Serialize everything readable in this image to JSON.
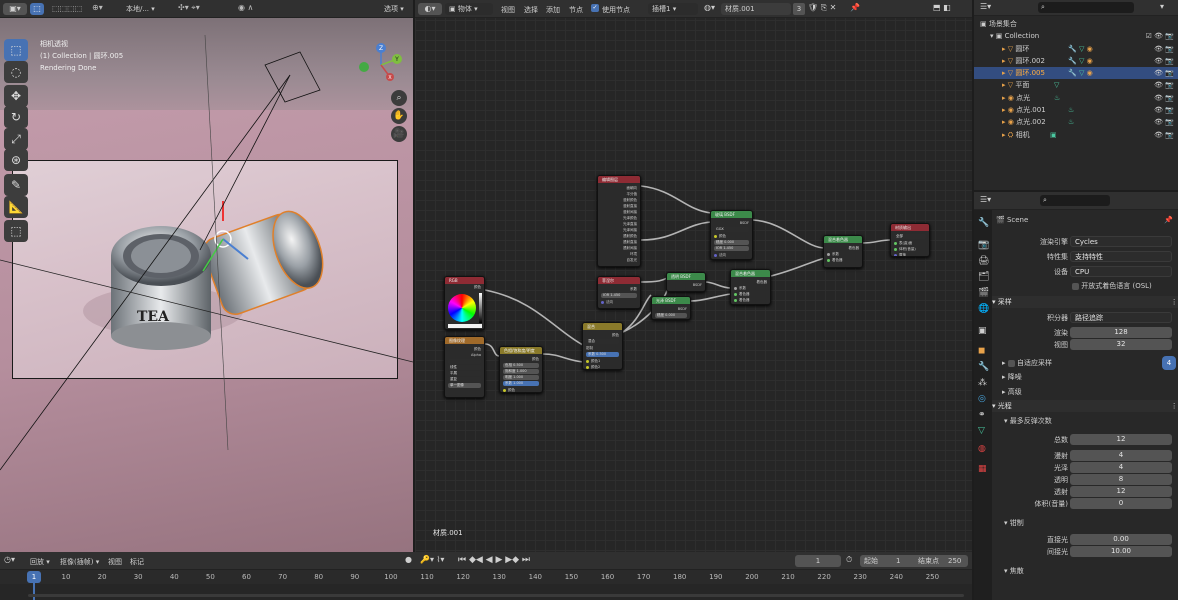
{
  "viewport": {
    "header": {
      "mode_label": "本地/...",
      "options_label": "选项"
    },
    "overlay": {
      "line1": "相机透视",
      "line2": "(1) Collection | 圆环.005",
      "line3": "Rendering Done"
    },
    "gizmo": {
      "x": "X",
      "y": "Y",
      "z": "Z"
    },
    "jar_label": "TEA"
  },
  "node_editor": {
    "header": {
      "object_label": "物体",
      "menu": [
        "视图",
        "选择",
        "添加",
        "节点"
      ],
      "use_nodes": "使用节点",
      "slot": "插槽1",
      "material": "材质.001",
      "users": "3"
    },
    "material_name": "材质.001",
    "nodes": [
      {
        "id": "n1",
        "title": "编辑图层",
        "color": "#8e2b34",
        "rows": [
          "面朝向",
          "平分值",
          "漫射颜色",
          "漫射直接",
          "漫射间接",
          "光泽颜色",
          "光泽直接",
          "光泽间接",
          "透射颜色",
          "透射直接",
          "透射间接",
          "环境",
          "自发光",
          "透视遮罩",
          "矢量",
          "法向"
        ]
      },
      {
        "id": "n2",
        "title": "玻璃 BSDF",
        "color": "#3c8a4a",
        "rows": [
          "BSDF",
          "GGX",
          "颜色",
          "糙度 0.000",
          "IOR 1.450",
          "法向"
        ]
      },
      {
        "id": "n3",
        "title": "混合着色器",
        "color": "#3c8a4a",
        "rows": [
          "着色器",
          "系数",
          "着色器",
          "着色器"
        ]
      },
      {
        "id": "n4",
        "title": "材质输出",
        "color": "#8e2b34",
        "rows": [
          "全部",
          "表(曲)面",
          "体积(音量)",
          "置换"
        ]
      },
      {
        "id": "n5",
        "title": "菲涅尔",
        "color": "#8e2b34",
        "rows": [
          "系数",
          "IOR 1.450",
          "法向"
        ]
      },
      {
        "id": "n6",
        "title": "透明 BSDF",
        "color": "#3c8a4a",
        "rows": [
          "BSDF",
          "颜色"
        ]
      },
      {
        "id": "n7",
        "title": "光泽 BSDF",
        "color": "#3c8a4a",
        "rows": [
          "BSDF",
          "GGX",
          "颜色",
          "糙度 0.000"
        ]
      },
      {
        "id": "n8",
        "title": "混合着色器",
        "color": "#3c8a4a",
        "rows": [
          "着色器",
          "系数",
          "着色器",
          "着色器"
        ]
      },
      {
        "id": "n9",
        "title": "RGB",
        "color": "#8e2b34",
        "rows": [
          "颜色"
        ]
      },
      {
        "id": "n10",
        "title": "图像纹理",
        "color": "#a06a2a",
        "rows": [
          "颜色",
          "Alpha",
          "线性",
          "平展",
          "重复",
          "单一图像"
        ]
      },
      {
        "id": "n11",
        "title": "色相/饱和度/明度",
        "color": "#8a7a2a",
        "rows": [
          "颜色",
          "色相 0.500",
          "饱和度 1.000",
          "明度 1.000",
          "系数 1.000",
          "颜色"
        ]
      },
      {
        "id": "n12",
        "title": "混合",
        "color": "#8a7a2a",
        "rows": [
          "颜色",
          "混合",
          "钳制",
          "系数 0.500",
          "颜色1",
          "颜色2"
        ]
      }
    ]
  },
  "outliner": {
    "title": "场景集合",
    "items": [
      {
        "name": "Collection",
        "indent": 1
      },
      {
        "name": "圆环",
        "indent": 2
      },
      {
        "name": "圆环.002",
        "indent": 2
      },
      {
        "name": "圆环.005",
        "indent": 2,
        "selected": true
      },
      {
        "name": "平面",
        "indent": 2
      },
      {
        "name": "点光",
        "indent": 2
      },
      {
        "name": "点光.001",
        "indent": 2
      },
      {
        "name": "点光.002",
        "indent": 2
      },
      {
        "name": "相机",
        "indent": 2
      }
    ]
  },
  "properties": {
    "scene_name": "Scene",
    "render_engine_label": "渲染引擎",
    "render_engine": "Cycles",
    "feature_set_label": "特性集",
    "feature_set": "支持特性",
    "device_label": "设备",
    "device": "CPU",
    "osl_label": "开放式着色语言 (OSL)",
    "sampling": {
      "title": "采样",
      "integrator_label": "积分器",
      "integrator": "路径追踪",
      "render_label": "渲染",
      "render": "128",
      "viewport_label": "视图",
      "viewport": "32",
      "adaptive": "自适应采样",
      "denoise": "降噪",
      "advanced": "高级"
    },
    "light_paths": {
      "title": "光程",
      "max_bounces": "最多反弹次数",
      "total_label": "总数",
      "total": "12",
      "diffuse_label": "漫射",
      "diffuse": "4",
      "glossy_label": "光泽",
      "glossy": "4",
      "transparency_label": "透明",
      "transparency": "8",
      "transmission_label": "透射",
      "transmission": "12",
      "volume_label": "体积(音量)",
      "volume": "0"
    },
    "clamping": {
      "title": "钳制",
      "direct_label": "直接光",
      "direct": "0.00",
      "indirect_label": "间接光",
      "indirect": "10.00"
    },
    "caustics": {
      "title": "焦散"
    },
    "badge": "4"
  },
  "timeline": {
    "menu": [
      "回放",
      "抠像(插帧)",
      "视图",
      "标记"
    ],
    "current_frame": "1",
    "start_label": "起始",
    "start": "1",
    "end_label": "结束点",
    "end": "250",
    "ticks": [
      "1",
      "10",
      "20",
      "30",
      "40",
      "50",
      "60",
      "70",
      "80",
      "90",
      "100",
      "110",
      "120",
      "130",
      "140",
      "150",
      "160",
      "170",
      "180",
      "190",
      "200",
      "210",
      "220",
      "230",
      "240",
      "250"
    ]
  }
}
